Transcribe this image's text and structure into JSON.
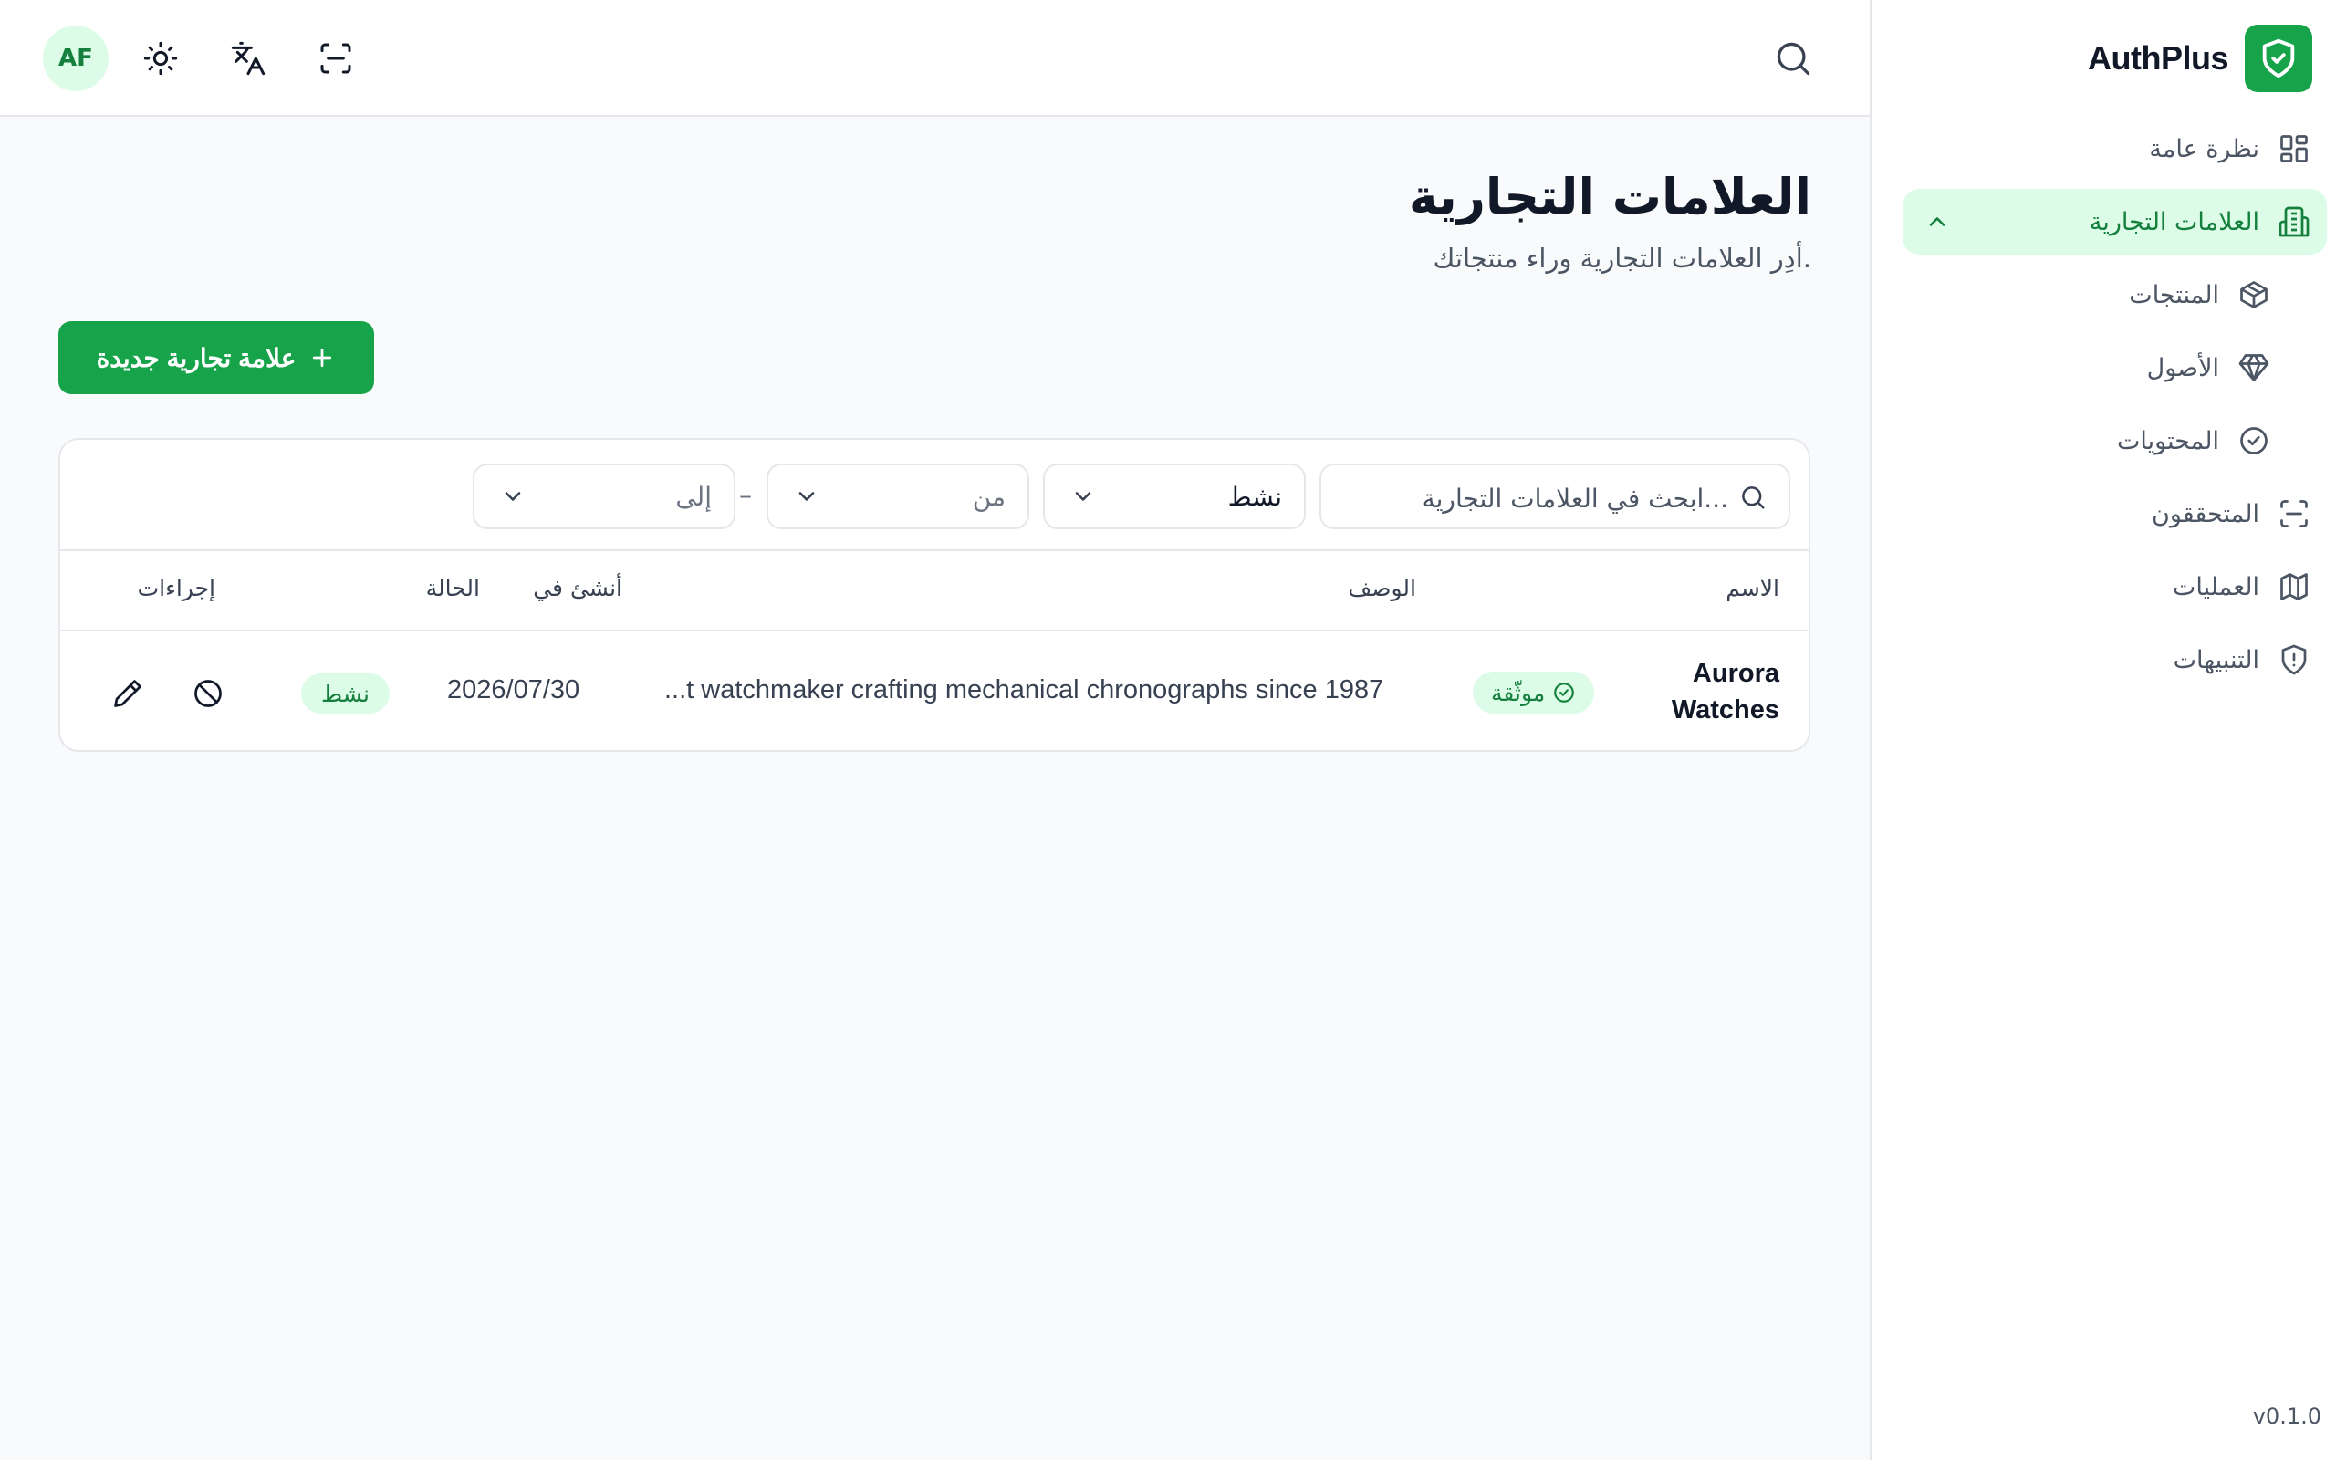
{
  "app": {
    "name": "AuthPlus",
    "version": "v0.1.0"
  },
  "sidebar": {
    "items": [
      {
        "label": "نظرة عامة",
        "icon": "dashboard-icon"
      },
      {
        "label": "العلامات التجارية",
        "icon": "building-icon",
        "active": true,
        "expanded": true
      },
      {
        "label": "المنتجات",
        "icon": "package-icon"
      },
      {
        "label": "الأصول",
        "icon": "gem-icon"
      },
      {
        "label": "المحتويات",
        "icon": "check-circle-icon"
      },
      {
        "label": "المتحققون",
        "icon": "scan-icon"
      },
      {
        "label": "العمليات",
        "icon": "map-icon"
      },
      {
        "label": "التنبيهات",
        "icon": "shield-alert-icon"
      }
    ]
  },
  "header": {
    "avatar_initials": "AF",
    "icons": [
      "sun-icon",
      "language-icon",
      "scan-icon",
      "search-icon"
    ]
  },
  "page": {
    "title": "العلامات التجارية",
    "subtitle": "أدِر العلامات التجارية وراء منتجاتك.",
    "new_button_label": "علامة تجارية جديدة"
  },
  "filters": {
    "search_placeholder": "ابحث في العلامات التجارية...",
    "status_value": "نشط",
    "from_placeholder": "من",
    "to_placeholder": "إلى",
    "range_separator": "–"
  },
  "table": {
    "columns": {
      "name": "الاسم",
      "description": "الوصف",
      "created_at": "أنشئ في",
      "status": "الحالة",
      "actions": "إجراءات"
    },
    "rows": [
      {
        "name_line1": "Aurora",
        "name_line2": "Watches",
        "verified_label": "موثّقة",
        "description": "...t watchmaker crafting mechanical chronographs since 1987",
        "created_at": "2026/07/30",
        "status": "نشط"
      }
    ]
  },
  "colors": {
    "accent": "#16a34a",
    "accent_light": "#dcfce7",
    "accent_text": "#15803d"
  }
}
